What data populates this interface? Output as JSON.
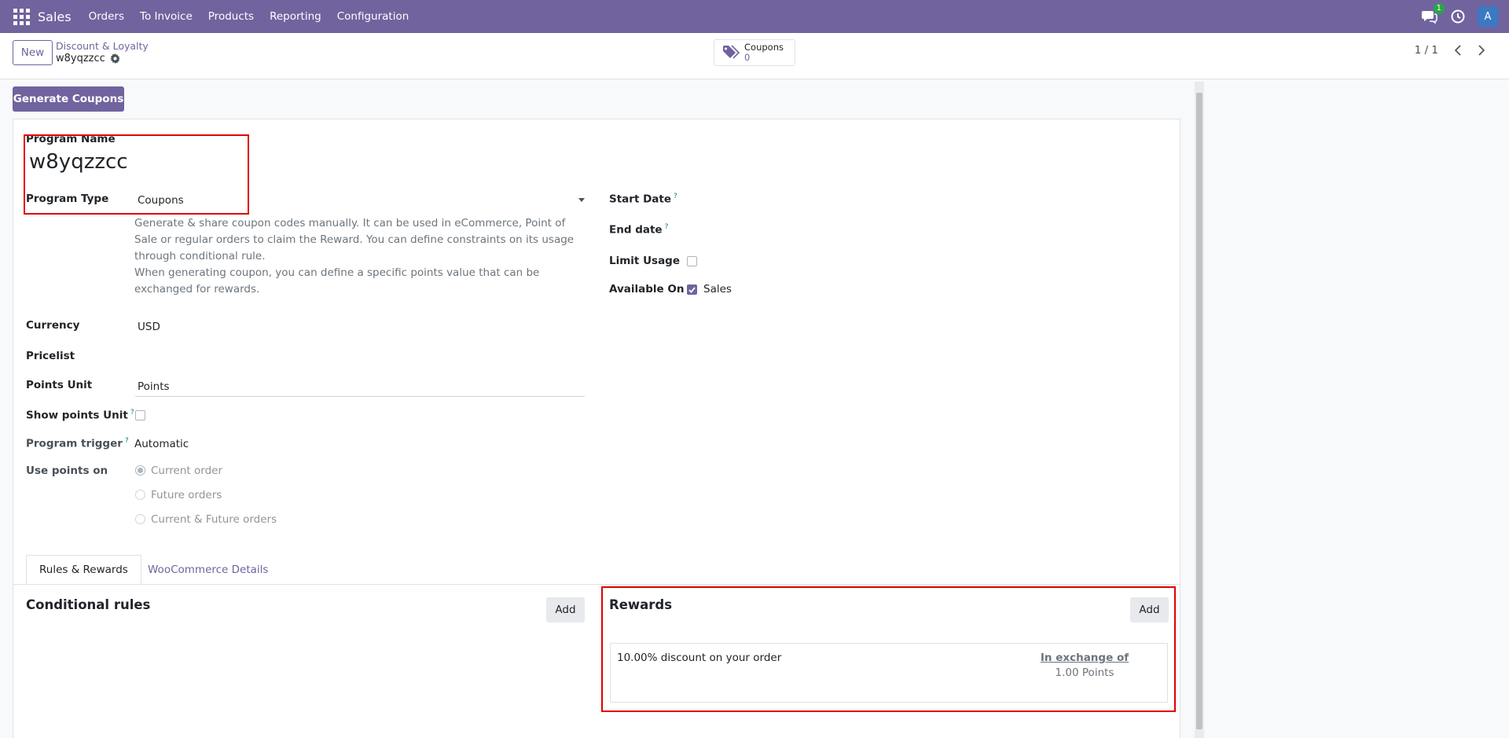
{
  "navbar": {
    "app_name": "Sales",
    "menu": [
      "Orders",
      "To Invoice",
      "Products",
      "Reporting",
      "Configuration"
    ],
    "chat_badge": "1",
    "avatar_letter": "A",
    "color": "#71639e"
  },
  "control_panel": {
    "new_label": "New",
    "breadcrumb_parent": "Discount & Loyalty",
    "breadcrumb_current": "w8yqzzcc",
    "coupons_label": "Coupons",
    "coupons_count": "0",
    "pager": "1 / 1"
  },
  "actions": {
    "generate_coupons": "Generate Coupons"
  },
  "form": {
    "program_name_label": "Program Name",
    "program_name_value": "w8yqzzcc",
    "program_type_label": "Program Type",
    "program_type_value": "Coupons",
    "description_1": "Generate & share coupon codes manually. It can be used in eCommerce, Point of Sale or regular orders to claim the Reward. You can define constraints on its usage through conditional rule.",
    "description_2": "When generating coupon, you can define a specific points value that can be exchanged for rewards.",
    "currency_label": "Currency",
    "currency_value": "USD",
    "pricelist_label": "Pricelist",
    "points_unit_label": "Points Unit",
    "points_unit_value": "Points",
    "show_points_unit_label": "Show points Unit",
    "program_trigger_label": "Program trigger",
    "program_trigger_value": "Automatic",
    "use_points_on_label": "Use points on",
    "use_points_options": [
      "Current order",
      "Future orders",
      "Current & Future orders"
    ],
    "use_points_selected": "Current order",
    "start_date_label": "Start Date",
    "end_date_label": "End date",
    "limit_usage_label": "Limit Usage",
    "limit_usage_checked": false,
    "available_on_label": "Available On",
    "available_on_option": "Sales",
    "available_on_checked": true,
    "help_mark": "?"
  },
  "tabs": [
    "Rules & Rewards",
    "WooCommerce Details"
  ],
  "rules": {
    "title": "Conditional rules",
    "add_label": "Add"
  },
  "rewards": {
    "title": "Rewards",
    "add_label": "Add",
    "items": [
      {
        "description": "10.00% discount on your order",
        "exchange_label": "In exchange of",
        "points": "1.00 Points"
      }
    ]
  }
}
